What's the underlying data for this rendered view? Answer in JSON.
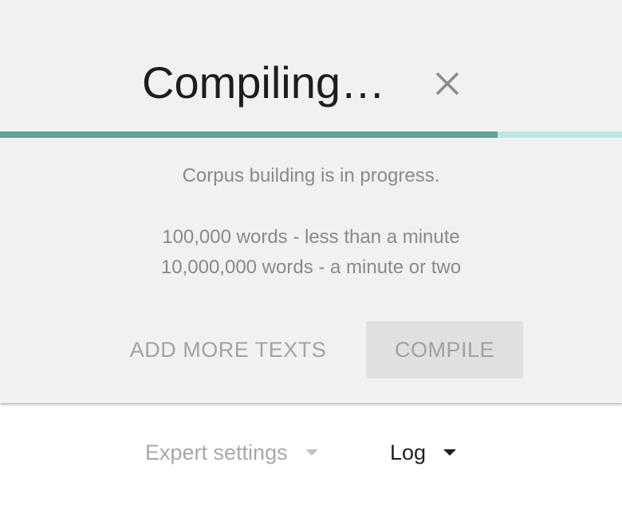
{
  "dialog": {
    "title": "Compiling…",
    "close_icon": "close-icon",
    "progress": {
      "fraction": 0.8,
      "fill_color": "#5da596",
      "track_color": "#bde8e1"
    },
    "status_message": "Corpus building is in progress.",
    "estimate_line_1": "100,000 words - less than a minute",
    "estimate_line_2": "10,000,000 words - a minute or two",
    "add_more_label": "ADD MORE TEXTS",
    "compile_label": "COMPILE"
  },
  "footer": {
    "expert_settings_label": "Expert settings",
    "log_label": "Log"
  }
}
